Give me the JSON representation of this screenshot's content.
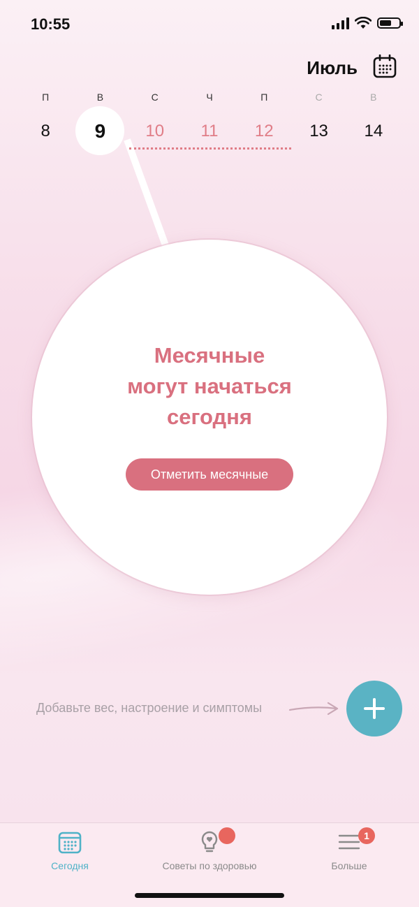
{
  "status_bar": {
    "time": "10:55"
  },
  "header": {
    "month": "Июль"
  },
  "week": [
    {
      "letter": "П",
      "number": "8",
      "state": "normal"
    },
    {
      "letter": "В",
      "number": "9",
      "state": "today"
    },
    {
      "letter": "С",
      "number": "10",
      "state": "period"
    },
    {
      "letter": "Ч",
      "number": "11",
      "state": "period"
    },
    {
      "letter": "П",
      "number": "12",
      "state": "period"
    },
    {
      "letter": "С",
      "number": "13",
      "state": "weekend"
    },
    {
      "letter": "В",
      "number": "14",
      "state": "weekend"
    }
  ],
  "main_card": {
    "line1": "Месячные",
    "line2": "могут начаться",
    "line3": "сегодня",
    "button_label": "Отметить месячные"
  },
  "add_hint": "Добавьте вес, настроение и симптомы",
  "tabs": [
    {
      "label": "Сегодня",
      "active": true
    },
    {
      "label": "Советы по здоровью",
      "badge": ""
    },
    {
      "label": "Больше",
      "badge": "1"
    }
  ],
  "colors": {
    "accent_pink": "#d9707f",
    "accent_teal": "#5ab3c4",
    "badge_red": "#e8665e"
  }
}
